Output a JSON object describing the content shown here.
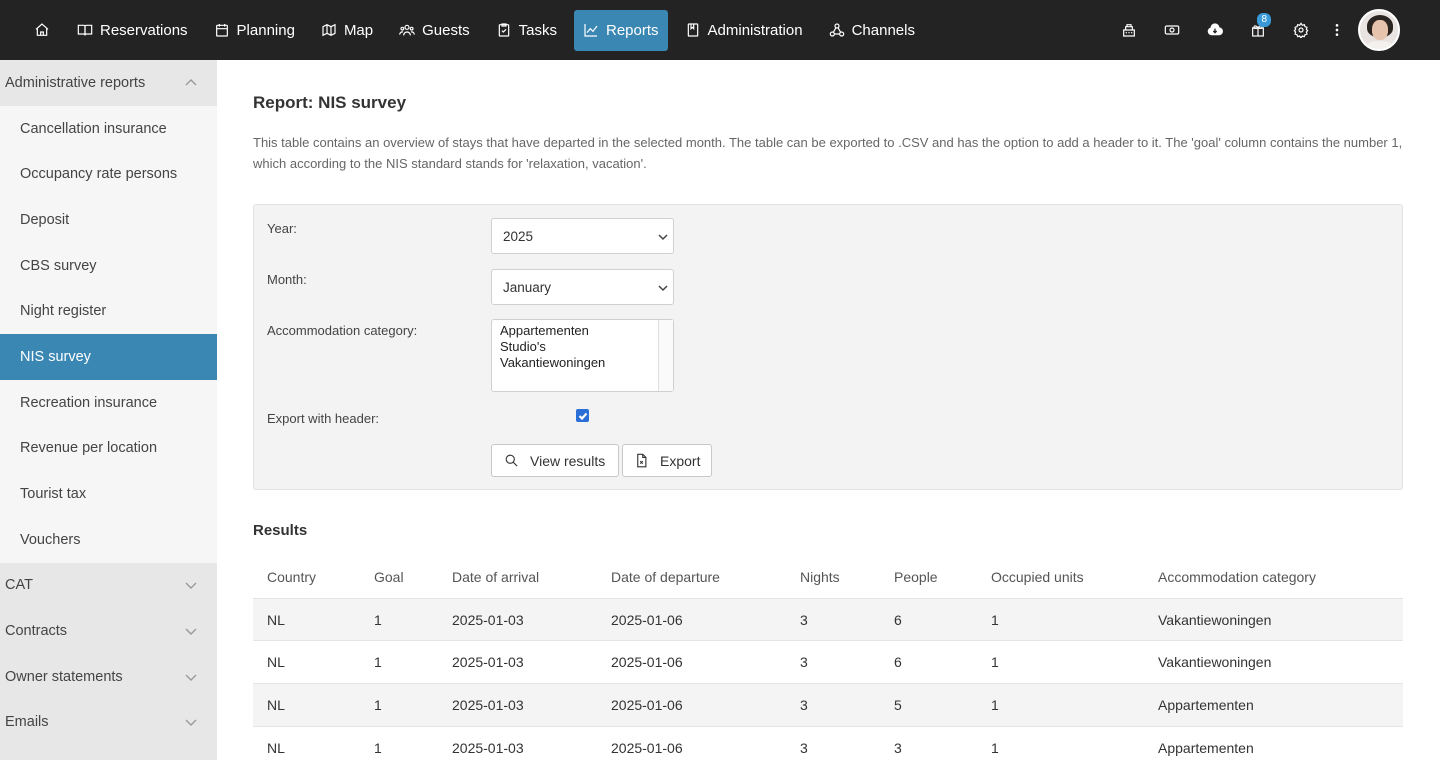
{
  "nav": {
    "items": [
      {
        "label": "Reservations",
        "icon": "book-icon"
      },
      {
        "label": "Planning",
        "icon": "calendar-icon"
      },
      {
        "label": "Map",
        "icon": "map-icon"
      },
      {
        "label": "Guests",
        "icon": "users-icon"
      },
      {
        "label": "Tasks",
        "icon": "clipboard-icon"
      },
      {
        "label": "Reports",
        "icon": "chart-icon",
        "active": true
      },
      {
        "label": "Administration",
        "icon": "ledger-icon"
      },
      {
        "label": "Channels",
        "icon": "network-icon"
      }
    ],
    "gift_badge": "8",
    "accent_color": "#3a87b4"
  },
  "sidebar": {
    "groups": [
      {
        "label": "Administrative reports",
        "expanded": true
      },
      {
        "label": "CAT"
      },
      {
        "label": "Contracts"
      },
      {
        "label": "Owner statements"
      },
      {
        "label": "Emails"
      }
    ],
    "items": [
      "Cancellation insurance",
      "Occupancy rate persons",
      "Deposit",
      "CBS survey",
      "Night register",
      "NIS survey",
      "Recreation insurance",
      "Revenue per location",
      "Tourist tax",
      "Vouchers"
    ],
    "active_item": "NIS survey"
  },
  "report": {
    "title": "Report: NIS survey",
    "description": "This table contains an overview of stays that have departed in the selected month. The table can be exported to .CSV and has the option to add a header to it. The 'goal' column contains the number 1, which according to the NIS standard stands for 'relaxation, vacation'."
  },
  "filters": {
    "year_label": "Year:",
    "year_value": "2025",
    "month_label": "Month:",
    "month_value": "January",
    "category_label": "Accommodation category:",
    "category_options": [
      "Appartementen",
      "Studio's",
      "Vakantiewoningen"
    ],
    "export_header_label": "Export with header:",
    "export_header_checked": true,
    "view_button": "View results",
    "export_button": "Export"
  },
  "results": {
    "title": "Results",
    "columns": [
      "Country",
      "Goal",
      "Date of arrival",
      "Date of departure",
      "Nights",
      "People",
      "Occupied units",
      "Accommodation category"
    ],
    "rows": [
      [
        "NL",
        "1",
        "2025-01-03",
        "2025-01-06",
        "3",
        "6",
        "1",
        "Vakantiewoningen"
      ],
      [
        "NL",
        "1",
        "2025-01-03",
        "2025-01-06",
        "3",
        "6",
        "1",
        "Vakantiewoningen"
      ],
      [
        "NL",
        "1",
        "2025-01-03",
        "2025-01-06",
        "3",
        "5",
        "1",
        "Appartementen"
      ],
      [
        "NL",
        "1",
        "2025-01-03",
        "2025-01-06",
        "3",
        "3",
        "1",
        "Appartementen"
      ]
    ]
  }
}
